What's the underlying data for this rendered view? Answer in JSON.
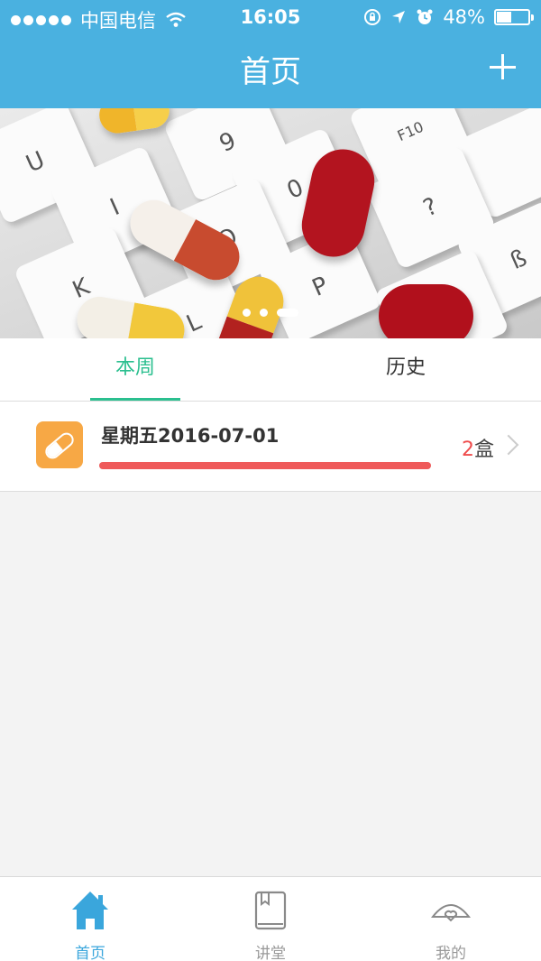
{
  "status_bar": {
    "carrier": "中国电信",
    "time": "16:05",
    "battery_percent_text": "48%",
    "battery_level": 0.48
  },
  "header": {
    "title": "首页",
    "add_icon": "plus-icon",
    "color": "#4ab1e0"
  },
  "banner": {
    "slide_count": 3,
    "active_slide": 3,
    "key_labels": [
      "U",
      "9",
      "F10",
      "I",
      "0",
      "?",
      "ß",
      "O",
      "P",
      "K",
      "L",
      "@"
    ]
  },
  "tabs": [
    {
      "label": "本周",
      "selected": true
    },
    {
      "label": "历史",
      "selected": false
    }
  ],
  "accent_color": "#2bbf8f",
  "list": [
    {
      "icon": "pill-icon",
      "title": "星期五2016-07-01",
      "progress": 1.0,
      "count_number": "2",
      "count_unit": "盒"
    }
  ],
  "tabbar": {
    "items": [
      {
        "label": "首页",
        "icon": "home-icon",
        "active": true
      },
      {
        "label": "讲堂",
        "icon": "book-icon",
        "active": false
      },
      {
        "label": "我的",
        "icon": "profile-icon",
        "active": false
      }
    ],
    "active_color": "#3aa6dc"
  }
}
